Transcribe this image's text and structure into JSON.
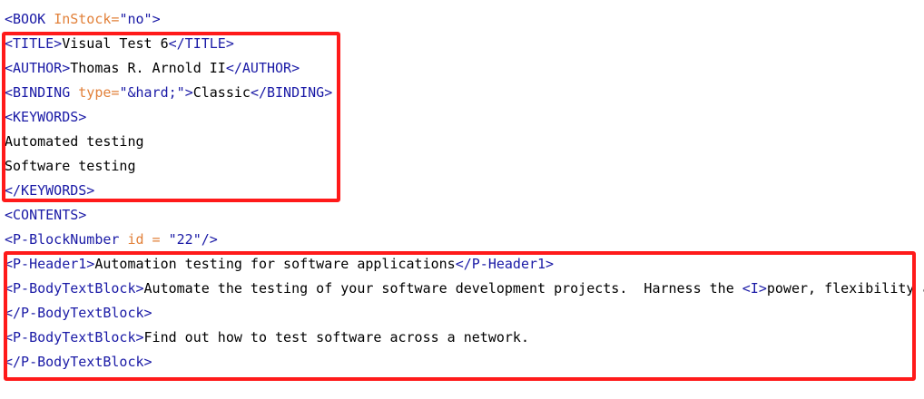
{
  "editor": {
    "lines": [
      {
        "segments": [
          {
            "t": "tag",
            "v": "<BOOK "
          },
          {
            "t": "attr",
            "v": "InStock="
          },
          {
            "t": "val",
            "v": "\"no\""
          },
          {
            "t": "tag",
            "v": ">"
          }
        ]
      },
      {
        "segments": [
          {
            "t": "tag",
            "v": "<TITLE>"
          },
          {
            "t": "text",
            "v": "Visual Test 6"
          },
          {
            "t": "tag",
            "v": "</TITLE>"
          }
        ]
      },
      {
        "segments": [
          {
            "t": "tag",
            "v": "<AUTHOR>"
          },
          {
            "t": "text",
            "v": "Thomas R. Arnold II"
          },
          {
            "t": "tag",
            "v": "</AUTHOR>"
          }
        ]
      },
      {
        "segments": [
          {
            "t": "tag",
            "v": "<BINDING "
          },
          {
            "t": "attr",
            "v": "type="
          },
          {
            "t": "val",
            "v": "\"&hard;\""
          },
          {
            "t": "tag",
            "v": ">"
          },
          {
            "t": "text",
            "v": "Classic"
          },
          {
            "t": "tag",
            "v": "</BINDING>"
          }
        ]
      },
      {
        "segments": [
          {
            "t": "tag",
            "v": "<KEYWORDS>"
          }
        ]
      },
      {
        "segments": [
          {
            "t": "text",
            "v": "Automated testing"
          }
        ]
      },
      {
        "segments": [
          {
            "t": "text",
            "v": "Software testing"
          }
        ]
      },
      {
        "segments": [
          {
            "t": "tag",
            "v": "</KEYWORDS>"
          }
        ]
      },
      {
        "segments": [
          {
            "t": "tag",
            "v": "<CONTENTS>"
          }
        ]
      },
      {
        "segments": [
          {
            "t": "tag",
            "v": "<P-BlockNumber "
          },
          {
            "t": "attr",
            "v": "id = "
          },
          {
            "t": "val",
            "v": "\"22\""
          },
          {
            "t": "tag",
            "v": "/>"
          }
        ]
      },
      {
        "segments": [
          {
            "t": "tag",
            "v": "<P-Header1>"
          },
          {
            "t": "text",
            "v": "Automation testing for software applications"
          },
          {
            "t": "tag",
            "v": "</P-Header1>"
          }
        ]
      },
      {
        "segments": [
          {
            "t": "tag",
            "v": "<P-BodyTextBlock>"
          },
          {
            "t": "text",
            "v": "Automate the testing of your software development projects.  Harness the "
          },
          {
            "t": "tag",
            "v": "<I>"
          },
          {
            "t": "text",
            "v": "power, flexibility a"
          }
        ]
      },
      {
        "segments": [
          {
            "t": "tag",
            "v": "</P-BodyTextBlock>"
          }
        ]
      },
      {
        "segments": [
          {
            "t": "tag",
            "v": "<P-BodyTextBlock>"
          },
          {
            "t": "text",
            "v": "Find out how to test software across a network."
          }
        ]
      },
      {
        "segments": [
          {
            "t": "tag",
            "v": "</P-BodyTextBlock>"
          }
        ]
      }
    ]
  },
  "colors": {
    "tag": "#1a1aa6",
    "attribute": "#e2813a",
    "text": "#000000",
    "highlight_box": "#ff1a1a"
  }
}
